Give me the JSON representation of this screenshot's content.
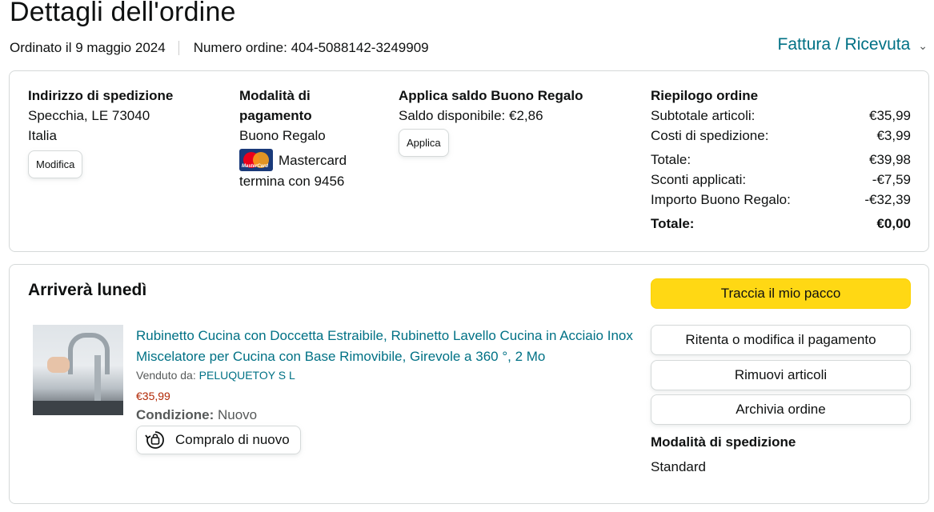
{
  "header": {
    "title": "Dettagli dell'ordine",
    "ordered_on": "Ordinato il 9 maggio 2024",
    "order_number": "Numero ordine: 404-5088142-3249909",
    "invoice_link": "Fattura / Ricevuta",
    "invoice_icon": "chevron-down-icon"
  },
  "shipping_address": {
    "heading": "Indirizzo di spedizione",
    "line1": "Specchia, LE 73040",
    "line2": "Italia",
    "edit_button": "Modifica"
  },
  "payment": {
    "heading_line1": "Modalità di",
    "heading_line2": "pagamento",
    "method1": "Buono Regalo",
    "card_name": "Mastercard",
    "card_ending": "termina con 9456",
    "card_icon": "mastercard-logo",
    "card_logo_text": "MasterCard"
  },
  "gift_card": {
    "heading": "Applica saldo Buono Regalo",
    "balance": "Saldo disponibile: €2,86",
    "apply_button": "Applica"
  },
  "summary": {
    "heading": "Riepilogo ordine",
    "rows": [
      {
        "label": "Subtotale articoli:",
        "value": "€35,99"
      },
      {
        "label": "Costi di spedizione:",
        "value": "€3,99"
      },
      {
        "label": "Totale:",
        "value": "€39,98"
      },
      {
        "label": "Sconti applicati:",
        "value": "-€7,59"
      },
      {
        "label": "Importo Buono Regalo:",
        "value": "-€32,39"
      }
    ],
    "grand_total_label": "Totale:",
    "grand_total_value": "€0,00"
  },
  "shipment": {
    "arrival": "Arriverà lunedì",
    "product": {
      "title": "Rubinetto Cucina con Doccetta Estraibile, Rubinetto Lavello Cucina in Acciaio Inox Miscelatore per Cucina con Base Rimovibile, Girevole a 360 °, 2 Mo",
      "sold_by_label": "Venduto da:",
      "seller": "PELUQUETOY S L",
      "price": "€35,99",
      "condition_label": "Condizione:",
      "condition_value": "Nuovo",
      "buy_again": "Compralo di nuovo",
      "buy_again_icon": "buy-again-icon"
    },
    "actions": {
      "track": "Traccia il mio pacco",
      "retry_payment": "Ritenta o modifica il pagamento",
      "remove_items": "Rimuovi articoli",
      "archive": "Archivia ordine"
    },
    "shipping_method_heading": "Modalità di spedizione",
    "shipping_method_value": "Standard"
  },
  "colors": {
    "link": "#007185",
    "price": "#B12704",
    "primary_button": "#FFD814",
    "border": "#D5D9D9"
  }
}
